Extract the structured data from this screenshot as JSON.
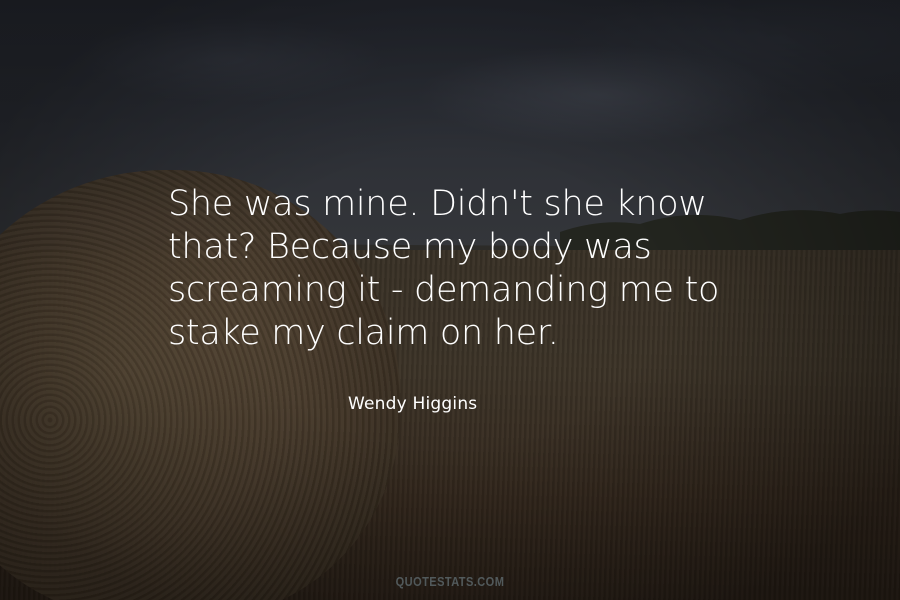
{
  "quote": {
    "lines": [
      "She was mine. Didn't she know",
      "that? Because my body was",
      "screaming it - demanding me to",
      "stake my claim on her."
    ],
    "author": "Wendy Higgins"
  },
  "watermark": "QUOTESTATS.COM",
  "colors": {
    "text": "#ffffff",
    "sky": "#2b2e35",
    "field": "#3d3428"
  }
}
